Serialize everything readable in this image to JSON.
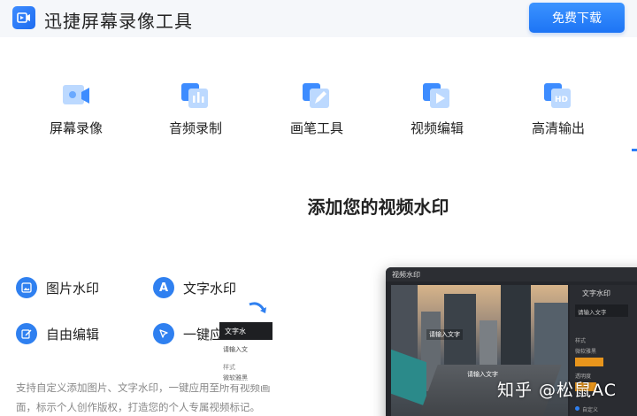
{
  "header": {
    "app_title": "迅捷屏幕录像工具",
    "download_label": "免费下载"
  },
  "features": [
    {
      "label": "屏幕录像",
      "icon": "screen-record-icon"
    },
    {
      "label": "音频录制",
      "icon": "audio-record-icon"
    },
    {
      "label": "画笔工具",
      "icon": "pen-tool-icon"
    },
    {
      "label": "视频编辑",
      "icon": "video-edit-icon"
    },
    {
      "label": "高清输出",
      "icon": "hd-output-icon"
    }
  ],
  "section": {
    "title": "添加您的视频水印",
    "options": [
      {
        "label": "图片水印",
        "icon": "image-icon"
      },
      {
        "label": "文字水印",
        "icon": "text-a-icon"
      },
      {
        "label": "自由编辑",
        "icon": "edit-icon"
      },
      {
        "label": "一键应用",
        "icon": "cursor-icon"
      }
    ],
    "description_line1": "支持自定义添加图片、文字水印，一键应用至所有视频画",
    "description_line2": "面，标示个人创作版权，打造您的个人专属视频标记。"
  },
  "preview": {
    "window_title": "视频水印",
    "panel_tab": "文字水印",
    "input_text": "请输入文字",
    "watermark_text": "请输入文字",
    "style_label": "样式",
    "color_label": "微软雅黑",
    "opacity_label": "透明度",
    "popup_title": "文字水",
    "popup_input": "请输入文",
    "popup_label": "样式",
    "popup_font": "微软雅黑",
    "radio_label": "自定义"
  },
  "overlay_watermark": "知乎 @松鼠AC",
  "colors": {
    "accent": "#2f80f0",
    "header_bg": "#f5f7fa",
    "button_gradient_top": "#3b93ff",
    "button_gradient_bottom": "#1d74f5",
    "preview_bg": "#24262b",
    "highlight_orange": "#e8951c"
  }
}
